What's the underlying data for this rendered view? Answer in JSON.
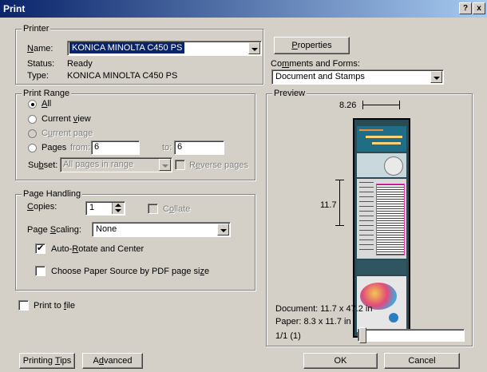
{
  "window": {
    "title": "Print",
    "help_btn": "?",
    "close_btn": "x"
  },
  "printer": {
    "group_label": "Printer",
    "name_label": "Name:",
    "name_value": "KONICA MINOLTA C450 PS",
    "status_label": "Status:",
    "status_value": "Ready",
    "type_label": "Type:",
    "type_value": "KONICA MINOLTA C450 PS",
    "properties_label": "Properties",
    "comments_label": "Comments and Forms:",
    "comments_value": "Document and Stamps"
  },
  "print_range": {
    "group_label": "Print Range",
    "all_label": "All",
    "current_view_label": "Current view",
    "current_page_label": "Current page",
    "pages_label": "Pages",
    "from_label": "from:",
    "from_value": "6",
    "to_label": "to:",
    "to_value": "6",
    "subset_label": "Subset:",
    "subset_value": "All pages in range",
    "reverse_label": "Reverse pages"
  },
  "page_handling": {
    "group_label": "Page Handling",
    "copies_label": "Copies:",
    "copies_value": "1",
    "collate_label": "Collate",
    "scaling_label": "Page Scaling:",
    "scaling_value": "None",
    "auto_rotate_label": "Auto-Rotate and Center",
    "choose_paper_label": "Choose Paper Source by PDF page size"
  },
  "print_to_file_label": "Print to file",
  "preview": {
    "group_label": "Preview",
    "width_dim": "8.26",
    "height_dim": "11.7",
    "document_size": "Document: 11.7 x 47.2 in",
    "paper_size": "Paper: 8.3 x 11.7 in",
    "page_counter": "1/1 (1)"
  },
  "buttons": {
    "printing_tips": "Printing Tips",
    "advanced": "Advanced",
    "ok": "OK",
    "cancel": "Cancel"
  }
}
